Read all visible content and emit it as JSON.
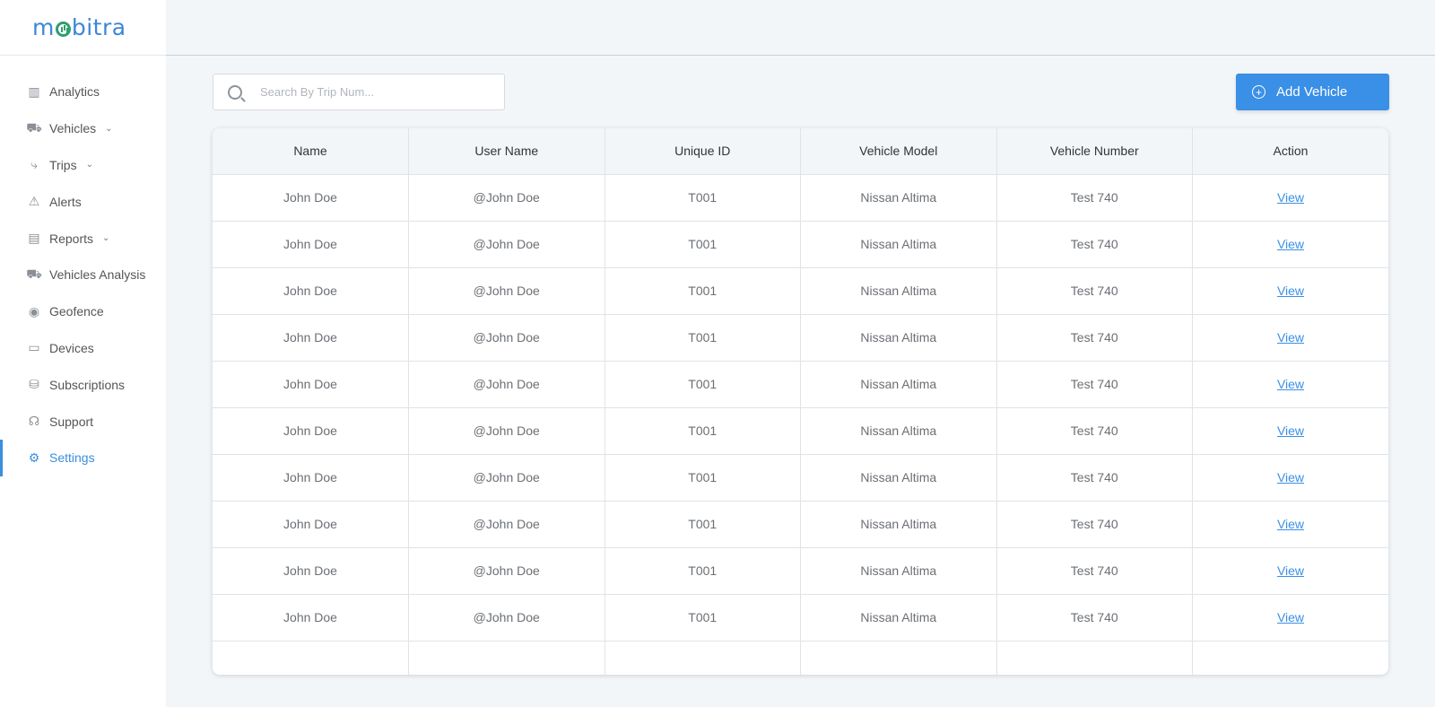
{
  "brand": {
    "logo_text_pre": "m",
    "logo_text_post": "bitra"
  },
  "sidebar": {
    "items": [
      {
        "label": "Analytics",
        "icon": "chart-icon",
        "glyph": "▥",
        "chevron": false,
        "active": false
      },
      {
        "label": "Vehicles",
        "icon": "truck-icon",
        "glyph": "⛟",
        "chevron": true,
        "active": false
      },
      {
        "label": "Trips",
        "icon": "route-icon",
        "glyph": "⤷",
        "chevron": true,
        "active": false
      },
      {
        "label": "Alerts",
        "icon": "warning-icon",
        "glyph": "⚠",
        "chevron": false,
        "active": false
      },
      {
        "label": "Reports",
        "icon": "report-icon",
        "glyph": "▤",
        "chevron": true,
        "active": false
      },
      {
        "label": "Vehicles Analysis",
        "icon": "vehicle-analysis-icon",
        "glyph": "⛟",
        "chevron": false,
        "active": false
      },
      {
        "label": "Geofence",
        "icon": "location-pin-icon",
        "glyph": "◉",
        "chevron": false,
        "active": false
      },
      {
        "label": "Devices",
        "icon": "device-icon",
        "glyph": "▭",
        "chevron": false,
        "active": false
      },
      {
        "label": "Subscriptions",
        "icon": "subscription-icon",
        "glyph": "⛁",
        "chevron": false,
        "active": false
      },
      {
        "label": "Support",
        "icon": "headset-icon",
        "glyph": "☊",
        "chevron": false,
        "active": false
      },
      {
        "label": "Settings",
        "icon": "gear-icon",
        "glyph": "⚙",
        "chevron": false,
        "active": true
      }
    ]
  },
  "search": {
    "placeholder": "Search By Trip Num...",
    "value": ""
  },
  "actions": {
    "add_vehicle_label": "Add Vehicle"
  },
  "table": {
    "columns": [
      "Name",
      "User Name",
      "Unique ID",
      "Vehicle Model",
      "Vehicle Number",
      "Action"
    ],
    "rows": [
      [
        "John Doe",
        "@John Doe",
        "T001",
        "Nissan Altima",
        "Test 740",
        "View"
      ],
      [
        "John Doe",
        "@John Doe",
        "T001",
        "Nissan Altima",
        "Test 740",
        "View"
      ],
      [
        "John Doe",
        "@John Doe",
        "T001",
        "Nissan Altima",
        "Test 740",
        "View"
      ],
      [
        "John Doe",
        "@John Doe",
        "T001",
        "Nissan Altima",
        "Test 740",
        "View"
      ],
      [
        "John Doe",
        "@John Doe",
        "T001",
        "Nissan Altima",
        "Test 740",
        "View"
      ],
      [
        "John Doe",
        "@John Doe",
        "T001",
        "Nissan Altima",
        "Test 740",
        "View"
      ],
      [
        "John Doe",
        "@John Doe",
        "T001",
        "Nissan Altima",
        "Test 740",
        "View"
      ],
      [
        "John Doe",
        "@John Doe",
        "T001",
        "Nissan Altima",
        "Test 740",
        "View"
      ],
      [
        "John Doe",
        "@John Doe",
        "T001",
        "Nissan Altima",
        "Test 740",
        "View"
      ],
      [
        "John Doe",
        "@John Doe",
        "T001",
        "Nissan Altima",
        "Test 740",
        "View"
      ]
    ]
  },
  "colors": {
    "accent": "#3a8fe6",
    "logo_green": "#2e9e6f",
    "logo_blue": "#3d86d9"
  }
}
